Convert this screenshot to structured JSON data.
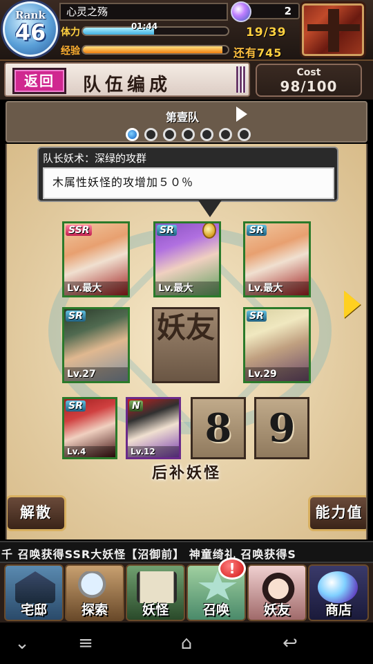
{
  "header": {
    "rank_label": "Rank",
    "rank_value": "46",
    "player_name": "心灵之殇",
    "stamina_label": "体力",
    "stamina_timer": "01:44",
    "stamina_value": "19/39",
    "stamina_ratio": 0.49,
    "exp_label": "经验",
    "exp_remaining_label": "还有",
    "exp_remaining_value": "745",
    "exp_ratio": 0.96,
    "gem_count": "2"
  },
  "title_bar": {
    "back_label": "返回",
    "title": "队伍编成",
    "cost_label": "Cost",
    "cost_value": "98/100"
  },
  "team": {
    "name": "第壹队",
    "dot_count": 7,
    "active_index": 0
  },
  "leader": {
    "title": "队长妖术：深绿的攻群",
    "description": "木属性妖怪的攻增加５０％"
  },
  "cards": {
    "front_1": {
      "rarity": "SSR",
      "level": "Lv.最大"
    },
    "front_2": {
      "rarity": "SR",
      "level": "Lv.最大"
    },
    "front_3": {
      "rarity": "SR",
      "level": "Lv.最大"
    },
    "back_1": {
      "rarity": "SR",
      "level": "Lv.27"
    },
    "back_3": {
      "rarity": "SR",
      "level": "Lv.29"
    },
    "reserve_1": {
      "rarity": "SR",
      "level": "Lv.4"
    },
    "reserve_2": {
      "rarity": "N",
      "level": "Lv.12"
    }
  },
  "friend_slot_label": "妖友",
  "reserve_slots": [
    "8",
    "9"
  ],
  "reserve_label": "后补妖怪",
  "buttons": {
    "disband": "解散",
    "stats": "能力值"
  },
  "ticker": "千 召唤获得SSR大妖怪【沼御前】    神童绮礼 召唤获得S",
  "bottom_nav": {
    "home": "宅邸",
    "explore": "探索",
    "yokai": "妖怪",
    "summon": "召唤",
    "friends": "妖友",
    "shop": "商店",
    "summon_badge": "!"
  },
  "colors": {
    "accent_pink": "#d02890",
    "stamina": "#40b0e0",
    "exp": "#f08010",
    "gold": "#ffd020"
  },
  "icons": {
    "back": "back-arrow-icon",
    "home": "house-icon",
    "explore": "magnifier-icon",
    "yokai": "scroll-icon",
    "summon": "star-seal-icon",
    "friends": "fox-girl-icon",
    "shop": "spirit-orb-icon"
  }
}
